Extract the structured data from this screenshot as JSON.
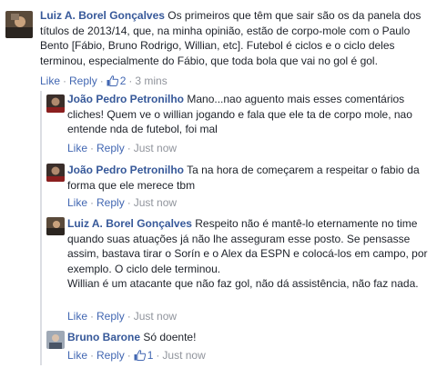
{
  "comments": [
    {
      "author": "Luiz A. Borel Gonçalves",
      "text": "Os primeiros que têm que sair são os da panela dos títulos de 2013/14, que, na minha opinião, estão de corpo-mole com o Paulo Bento [Fábio, Bruno Rodrigo, Willian, etc]. Futebol é ciclos e o ciclo deles terminou, especialmente do Fábio, que toda bola que vai no gol é gol.",
      "like": "Like",
      "reply": "Reply",
      "likes": "2",
      "time": "3 mins"
    },
    {
      "author": "João Pedro Petronilho",
      "text": "Mano...nao aguento mais esses comentários cliches! Quem ve o willian jogando e fala que ele ta de corpo mole, nao entende nda de futebol, foi mal",
      "like": "Like",
      "reply": "Reply",
      "time": "Just now"
    },
    {
      "author": "João Pedro Petronilho",
      "text": "Ta na hora de começarem a respeitar o fabio da forma que ele merece tbm",
      "like": "Like",
      "reply": "Reply",
      "time": "Just now"
    },
    {
      "author": "Luiz A. Borel Gonçalves",
      "text": "Respeito não é mantê-lo eternamente no time quando suas atuações já não lhe asseguram esse posto. Se pensasse assim, bastava tirar o Sorín e o Alex da ESPN e colocá-los em campo, por exemplo. O ciclo dele terminou.",
      "text2": "Willian é um atacante que não faz gol, não dá assistência, não faz nada.",
      "like": "Like",
      "reply": "Reply",
      "time": "Just now"
    },
    {
      "author": "Bruno Barone",
      "text": "Só doente!",
      "like": "Like",
      "reply": "Reply",
      "likes": "1",
      "time": "Just now"
    }
  ],
  "separator": "·",
  "colors": {
    "link": "#4267b2",
    "author": "#365899",
    "meta": "#90949c"
  },
  "icons": {
    "like": "thumbs-up-icon"
  }
}
